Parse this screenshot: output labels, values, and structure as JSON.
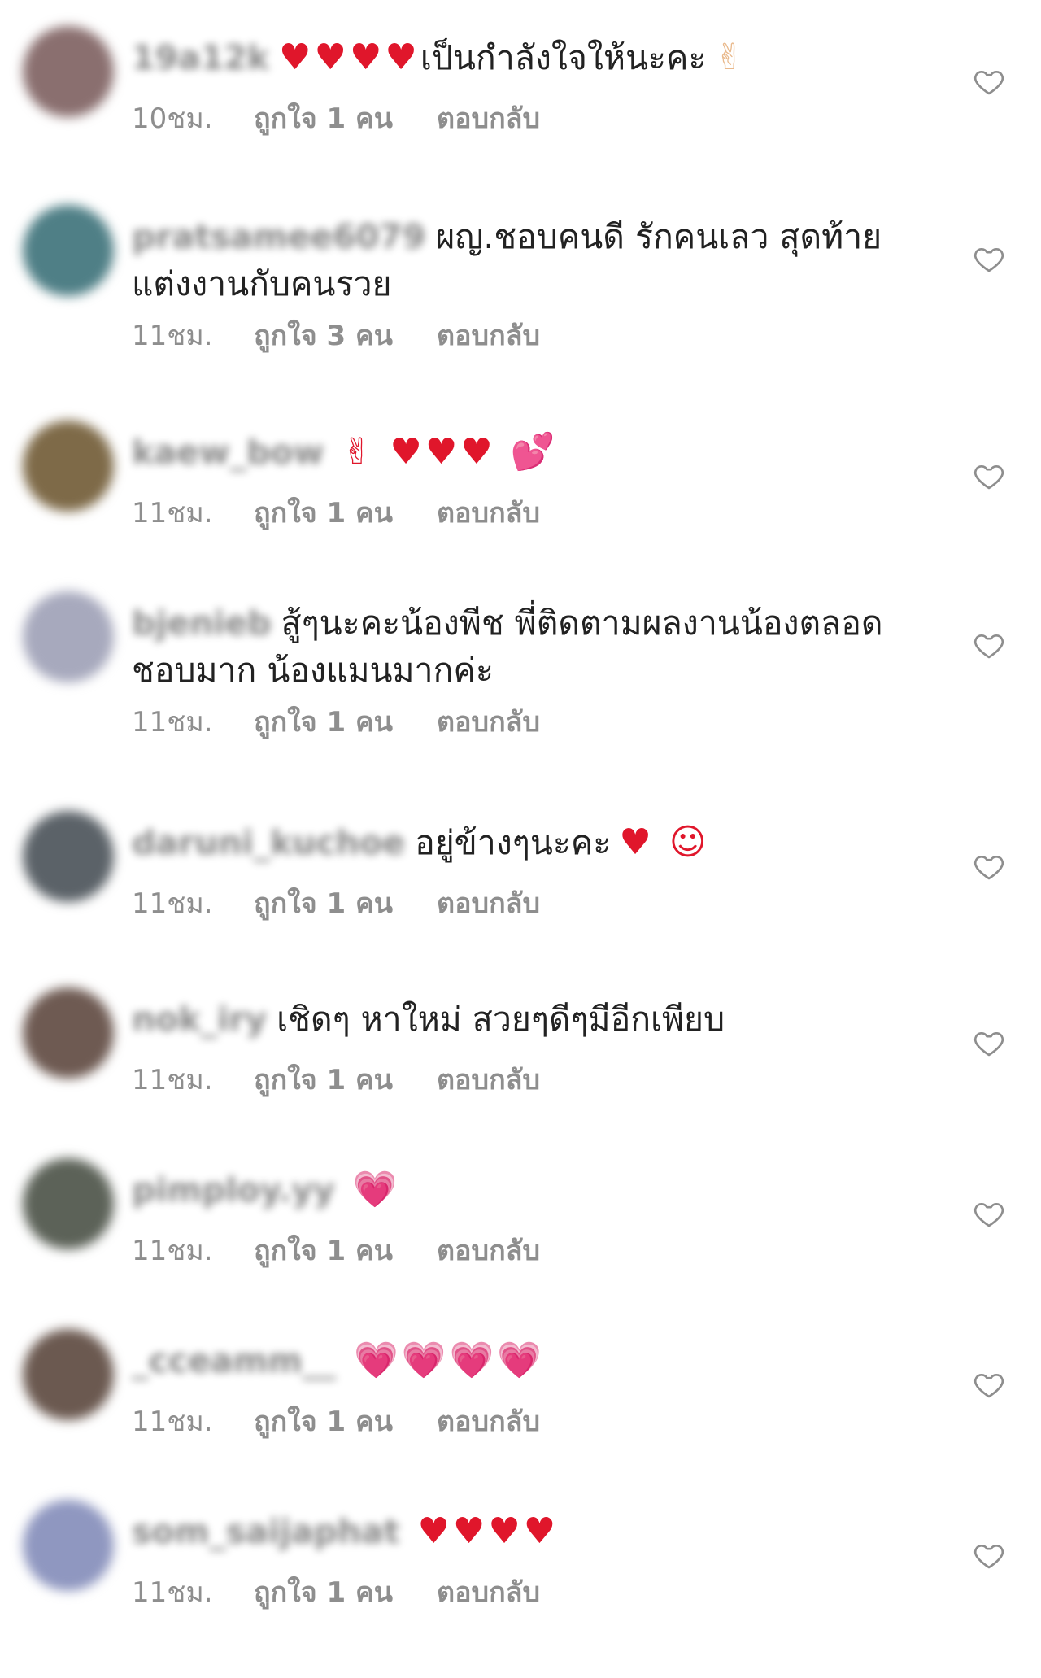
{
  "comments": [
    {
      "username": "19a12k",
      "text": "เป็นกำลังใจให้นะคะ",
      "emoji_before": "♥♥♥♥",
      "emoji_before_class": "red",
      "emoji_after": "✌",
      "emoji_after_class": "skin",
      "time": "10ชม.",
      "likes": "ถูกใจ 1 คน",
      "reply": "ตอบกลับ",
      "avatar_color": "#8a6f6f"
    },
    {
      "username": "pratsamee6079",
      "text": "ผญ.ชอบคนดี รักคนเลว สุดท้ายแต่งงานกับคนรวย",
      "emoji_before": "",
      "emoji_before_class": "",
      "emoji_after": "",
      "emoji_after_class": "",
      "time": "11ชม.",
      "likes": "ถูกใจ 3 คน",
      "reply": "ตอบกลับ",
      "avatar_color": "#4f7f86"
    },
    {
      "username": "kaew_bow",
      "text": "",
      "emoji_before": "",
      "emoji_before_class": "",
      "emoji_after": "✌ ♥♥♥ 💕",
      "emoji_after_class": "red",
      "time": "11ชม.",
      "likes": "ถูกใจ 1 คน",
      "reply": "ตอบกลับ",
      "avatar_color": "#7e6a48"
    },
    {
      "username": "bjenieb",
      "text": "สู้ๆนะคะน้องพีช พี่ติดตามผลงานน้องตลอด ชอบมาก น้องแมนมากค่ะ",
      "emoji_before": "",
      "emoji_before_class": "",
      "emoji_after": "",
      "emoji_after_class": "",
      "time": "11ชม.",
      "likes": "ถูกใจ 1 คน",
      "reply": "ตอบกลับ",
      "avatar_color": "#a7a9bd"
    },
    {
      "username": "daruni_kuchoe",
      "text": "อยู่ข้างๆนะคะ",
      "emoji_before": "",
      "emoji_before_class": "",
      "emoji_after": "♥ ☺",
      "emoji_after_class": "red",
      "time": "11ชม.",
      "likes": "ถูกใจ 1 คน",
      "reply": "ตอบกลับ",
      "avatar_color": "#5b6268"
    },
    {
      "username": "nok_iry",
      "text": "เชิดๆ หาใหม่ สวยๆดีๆมีอีกเพียบ",
      "emoji_before": "",
      "emoji_before_class": "",
      "emoji_after": "",
      "emoji_after_class": "",
      "time": "11ชม.",
      "likes": "ถูกใจ 1 คน",
      "reply": "ตอบกลับ",
      "avatar_color": "#6e5a52"
    },
    {
      "username": "pimploy.yy",
      "text": "",
      "emoji_before": "",
      "emoji_before_class": "",
      "emoji_after": "💗",
      "emoji_after_class": "pink",
      "time": "11ชม.",
      "likes": "ถูกใจ 1 คน",
      "reply": "ตอบกลับ",
      "avatar_color": "#5c6258"
    },
    {
      "username": "_cceamm__",
      "text": "",
      "emoji_before": "",
      "emoji_before_class": "",
      "emoji_after": "💗💗💗💗",
      "emoji_after_class": "pink",
      "time": "11ชม.",
      "likes": "ถูกใจ 1 คน",
      "reply": "ตอบกลับ",
      "avatar_color": "#6b5950"
    },
    {
      "username": "som_saijaphat",
      "text": "",
      "emoji_before": "",
      "emoji_before_class": "",
      "emoji_after": "♥♥♥♥",
      "emoji_after_class": "red",
      "time": "11ชม.",
      "likes": "ถูกใจ 1 คน",
      "reply": "ตอบกลับ",
      "avatar_color": "#8f97c0"
    }
  ],
  "like_icon": "heart-outline-icon"
}
